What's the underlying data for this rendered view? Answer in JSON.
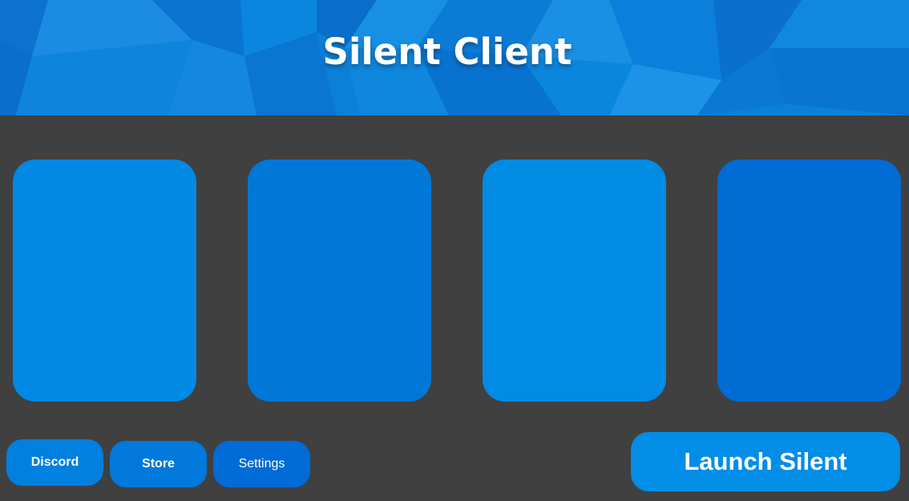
{
  "app": {
    "title": "Silent Client"
  },
  "cards": [
    {
      "id": "card-1"
    },
    {
      "id": "card-2"
    },
    {
      "id": "card-3"
    },
    {
      "id": "card-4"
    }
  ],
  "buttons": {
    "discord": "Discord",
    "store": "Store",
    "settings": "Settings",
    "launch": "Launch Silent"
  },
  "colors": {
    "background": "#404040",
    "header_blue": "#0a7fdc",
    "card_blue_light": "#0189e3",
    "card_blue_dark": "#006cd4",
    "text": "#ffffff"
  }
}
